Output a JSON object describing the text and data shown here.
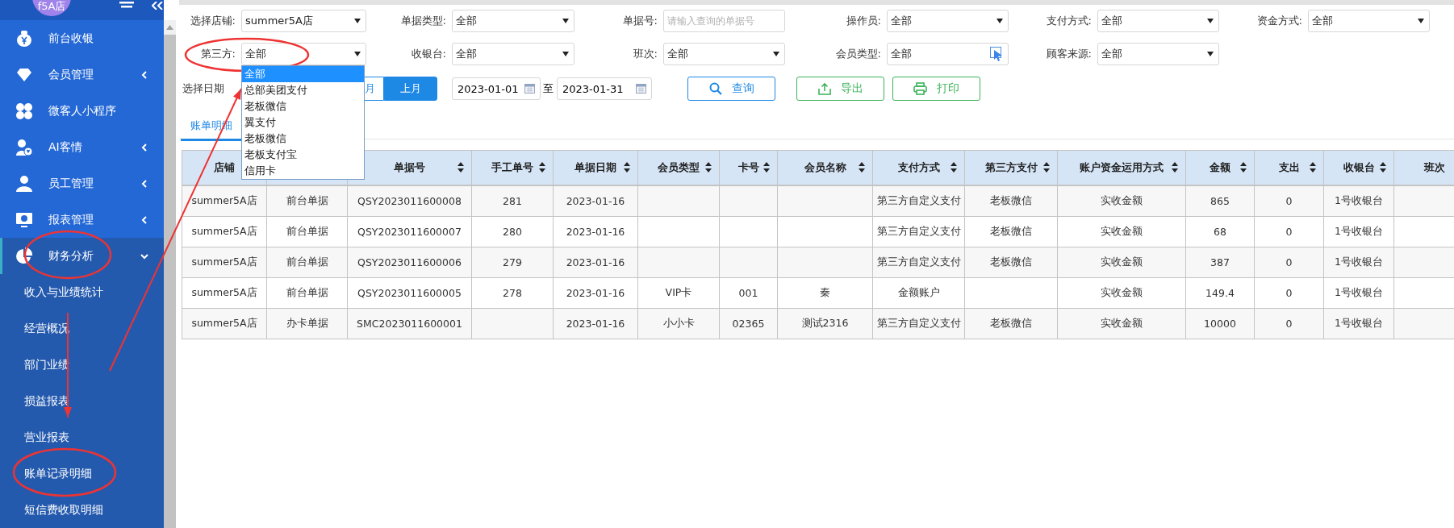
{
  "sidebar": {
    "logo_text": "f5A店",
    "items": [
      {
        "label": "前台收银"
      },
      {
        "label": "会员管理",
        "expanded": false
      },
      {
        "label": "微客人小程序"
      },
      {
        "label": "AI客情",
        "expanded": false
      },
      {
        "label": "员工管理",
        "expanded": false
      },
      {
        "label": "报表管理",
        "expanded": false
      },
      {
        "label": "财务分析",
        "expanded": true,
        "children": [
          {
            "label": "收入与业绩统计"
          },
          {
            "label": "经营概况"
          },
          {
            "label": "部门业绩"
          },
          {
            "label": "损益报表"
          },
          {
            "label": "营业报表"
          },
          {
            "label": "账单记录明细"
          },
          {
            "label": "短信费收取明细"
          }
        ]
      }
    ]
  },
  "filters": [
    {
      "label": "选择店铺:",
      "kind": "select",
      "value": "summer5A店"
    },
    {
      "label": "单据类型:",
      "kind": "select",
      "value": "全部"
    },
    {
      "label": "单据号:",
      "kind": "input",
      "placeholder": "请输入查询的单据号"
    },
    {
      "label": "操作员:",
      "kind": "select",
      "value": "全部"
    },
    {
      "label": "支付方式:",
      "kind": "select",
      "value": "全部"
    },
    {
      "label": "资金方式:",
      "kind": "select",
      "value": "全部"
    },
    {
      "label": "第三方:",
      "kind": "select",
      "value": "全部",
      "expanded": true,
      "options": [
        {
          "label": "全部",
          "selected": true
        },
        {
          "label": "总部美团支付",
          "selected": false
        },
        {
          "label": "老板微信",
          "selected": false
        },
        {
          "label": "翼支付",
          "selected": false
        },
        {
          "label": "老板微信",
          "selected": false
        },
        {
          "label": "老板支付宝",
          "selected": false
        },
        {
          "label": "信用卡",
          "selected": false
        }
      ]
    },
    {
      "label": "收银台:",
      "kind": "select",
      "value": "全部"
    },
    {
      "label": "班次:",
      "kind": "select",
      "value": "全部"
    },
    {
      "label": "会员类型:",
      "kind": "picker",
      "value": "全部"
    },
    {
      "label": "顾客来源:",
      "kind": "select",
      "value": "全部"
    }
  ],
  "date_range": {
    "label": "选择日期",
    "presets": [
      {
        "label": "月",
        "selected": false
      },
      {
        "label": "上月",
        "selected": true
      }
    ],
    "start": "2023-01-01",
    "separator": "至",
    "end": "2023-01-31"
  },
  "buttons": [
    {
      "label": "查询",
      "kind": "query"
    },
    {
      "label": "导出",
      "kind": "export"
    },
    {
      "label": "打印",
      "kind": "print"
    }
  ],
  "tabs": [
    {
      "label": "账单明细",
      "selected": true
    }
  ],
  "table": {
    "columns": [
      {
        "label": "店铺"
      },
      null,
      {
        "label": "单据号",
        "sortable": true
      },
      {
        "label": "手工单号",
        "sortable": true
      },
      {
        "label": "单据日期",
        "sortable": true
      },
      {
        "label": "会员类型",
        "sortable": true
      },
      {
        "label": "卡号",
        "sortable": true
      },
      {
        "label": "会员名称",
        "sortable": true
      },
      {
        "label": "支付方式",
        "sortable": true
      },
      {
        "label": "第三方支付",
        "sortable": true
      },
      {
        "label": "账户资金运用方式",
        "sortable": true
      },
      {
        "label": "金额",
        "sortable": true
      },
      {
        "label": "支出",
        "sortable": true
      },
      {
        "label": "收银台",
        "sortable": true
      },
      {
        "label": "班次"
      }
    ],
    "rows": [
      [
        "summer5A店",
        "前台单据",
        "QSY2023011600008",
        "281",
        "2023-01-16",
        null,
        null,
        null,
        "第三方自定义支付",
        "老板微信",
        "实收金额",
        "865",
        "0",
        "1号收银台",
        null
      ],
      [
        "summer5A店",
        "前台单据",
        "QSY2023011600007",
        "280",
        "2023-01-16",
        null,
        null,
        null,
        "第三方自定义支付",
        "老板微信",
        "实收金额",
        "68",
        "0",
        "1号收银台",
        null
      ],
      [
        "summer5A店",
        "前台单据",
        "QSY2023011600006",
        "279",
        "2023-01-16",
        null,
        null,
        null,
        "第三方自定义支付",
        "老板微信",
        "实收金额",
        "387",
        "0",
        "1号收银台",
        null
      ],
      [
        "summer5A店",
        "前台单据",
        "QSY2023011600005",
        "278",
        "2023-01-16",
        "VIP卡",
        "001",
        "秦",
        "金额账户",
        null,
        "实收金额",
        "149.4",
        "0",
        "1号收银台",
        null
      ],
      [
        "summer5A店",
        "办卡单据",
        "SMC2023011600001",
        null,
        "2023-01-16",
        "小小卡",
        "02365",
        "测试2316",
        "第三方自定义支付",
        "老板微信",
        "实收金额",
        "10000",
        "0",
        "1号收银台",
        null
      ]
    ]
  },
  "annotations": [
    {
      "kind": "ellipse"
    },
    {
      "kind": "ellipse"
    },
    {
      "kind": "ellipse"
    },
    {
      "kind": "arrow"
    },
    {
      "kind": "arrow"
    }
  ]
}
